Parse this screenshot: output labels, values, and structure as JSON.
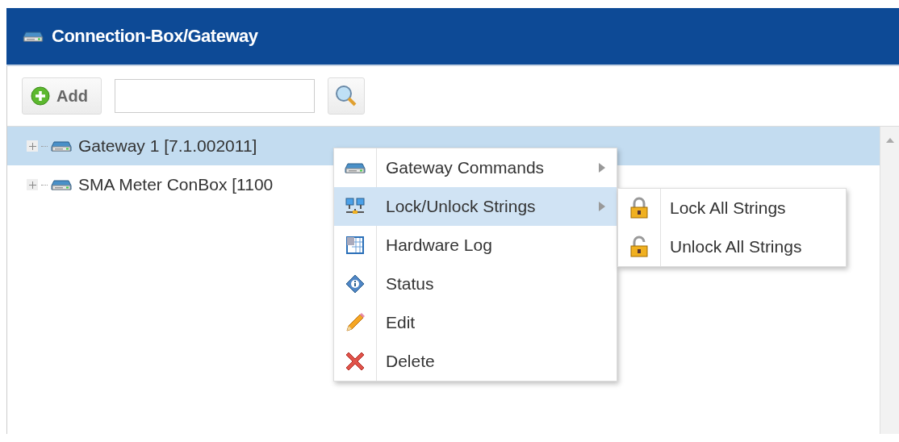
{
  "panel": {
    "title": "Connection-Box/Gateway"
  },
  "toolbar": {
    "add_button": "Add"
  },
  "tree": {
    "items": [
      {
        "label": "Gateway 1 [7.1.002011]",
        "selected": true,
        "expanded": false
      },
      {
        "label": "SMA Meter ConBox [1100",
        "selected": false,
        "expanded": false
      }
    ]
  },
  "context_menu": {
    "items": [
      {
        "label": "Gateway Commands",
        "selected": false,
        "submenu": true
      },
      {
        "label": "Lock/Unlock Strings",
        "selected": true,
        "submenu": true
      },
      {
        "label": "Hardware Log",
        "selected": false,
        "submenu": false
      },
      {
        "label": "Status",
        "selected": false,
        "submenu": false
      },
      {
        "label": "Edit",
        "selected": false,
        "submenu": false
      },
      {
        "label": "Delete",
        "selected": false,
        "submenu": false
      }
    ]
  },
  "submenu": {
    "items": [
      {
        "label": "Lock All Strings",
        "selected": false
      },
      {
        "label": "Unlock All Strings",
        "selected": false
      }
    ]
  }
}
